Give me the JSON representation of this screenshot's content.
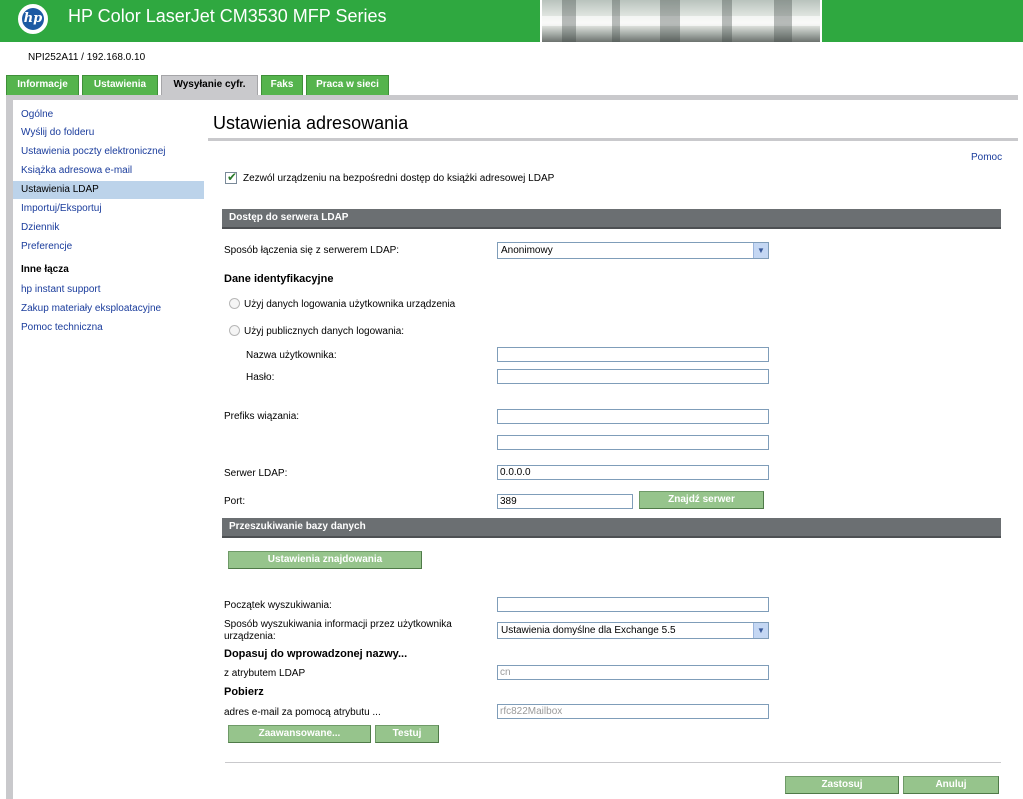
{
  "header": {
    "logo_text": "hp",
    "title": "HP Color LaserJet CM3530 MFP Series",
    "brand_color": "#2fa840"
  },
  "hostname": "NPI252A11 / 192.168.0.10",
  "tabs": [
    {
      "label": "Informacje",
      "active": false
    },
    {
      "label": "Ustawienia",
      "active": false
    },
    {
      "label": "Wysyłanie cyfr.",
      "active": true
    },
    {
      "label": "Faks",
      "active": false
    },
    {
      "label": "Praca w sieci",
      "active": false
    }
  ],
  "sidebar": {
    "items": [
      {
        "label": "Ogólne",
        "selected": false
      },
      {
        "label": "Wyślij do folderu",
        "selected": false
      },
      {
        "label": "Ustawienia poczty elektronicznej",
        "selected": false
      },
      {
        "label": "Książka adresowa e-mail",
        "selected": false
      },
      {
        "label": "Ustawienia LDAP",
        "selected": true
      },
      {
        "label": "Importuj/Eksportuj",
        "selected": false
      },
      {
        "label": "Dziennik",
        "selected": false
      },
      {
        "label": "Preferencje",
        "selected": false
      }
    ],
    "other_links_heading": "Inne łącza",
    "other_links": [
      {
        "label": "hp instant support"
      },
      {
        "label": "Zakup materiały eksploatacyjne"
      },
      {
        "label": "Pomoc techniczna"
      }
    ]
  },
  "main": {
    "page_title": "Ustawienia adresowania",
    "help_link": "Pomoc",
    "allow_ldap": {
      "label": "Zezwól urządzeniu na bezpośredni dostęp do książki adresowej LDAP",
      "checked": true
    },
    "ldap_section": {
      "title": "Dostęp do serwera LDAP",
      "bind_method_label": "Sposób łączenia się z serwerem LDAP:",
      "bind_method_value": "Anonimowy",
      "credentials_heading": "Dane identyfikacyjne",
      "radio_device_user": "Użyj danych logowania użytkownika urządzenia",
      "radio_public": "Użyj publicznych danych logowania:",
      "username_label": "Nazwa użytkownika:",
      "username_value": "",
      "password_label": "Hasło:",
      "password_value": "",
      "bind_prefix_label": "Prefiks wiązania:",
      "bind_prefix_value_1": "",
      "bind_prefix_value_2": "",
      "server_label": "Serwer LDAP:",
      "server_value": "0.0.0.0",
      "port_label": "Port:",
      "port_value": "389",
      "find_server_button": "Znajdź serwer"
    },
    "search_section": {
      "title": "Przeszukiwanie bazy danych",
      "search_settings_button": "Ustawienia znajdowania",
      "search_root_label": "Początek wyszukiwania:",
      "search_root_value": "",
      "method_label_line1": "Sposób wyszukiwania informacji przez użytkownika",
      "method_label_line2": "urządzenia:",
      "method_value": "Ustawienia domyślne dla Exchange 5.5",
      "match_heading": "Dopasuj do wprowadzonej nazwy...",
      "attribute_label": "z atrybutem LDAP",
      "attribute_value": "cn",
      "retrieve_heading": "Pobierz",
      "email_attribute_label": "adres e-mail za pomocą atrybutu ...",
      "email_attribute_value": "rfc822Mailbox",
      "advanced_button": "Zaawansowane...",
      "test_button": "Testuj"
    },
    "apply_button": "Zastosuj",
    "cancel_button": "Anuluj"
  }
}
